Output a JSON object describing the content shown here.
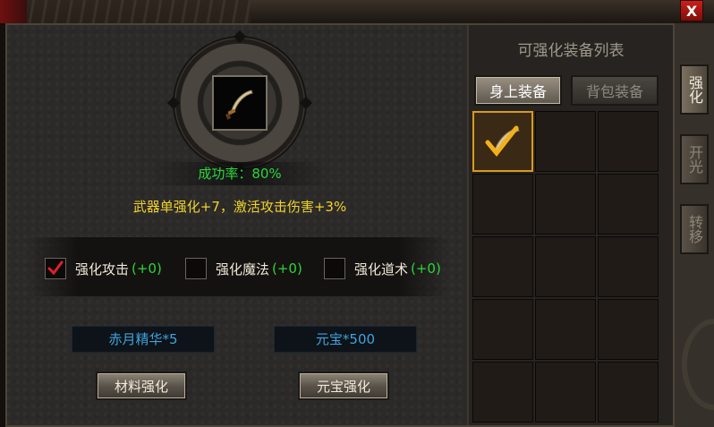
{
  "window": {
    "close_label": "X"
  },
  "enhance": {
    "success_rate": "成功率：80%",
    "description": "武器单强化+7，激活攻击伤害+3%",
    "options": [
      {
        "label": "强化攻击",
        "bonus": "(+0)",
        "checked": true
      },
      {
        "label": "强化魔法",
        "bonus": "(+0)",
        "checked": false
      },
      {
        "label": "强化道术",
        "bonus": "(+0)",
        "checked": false
      }
    ],
    "material_cost": "赤月精华*5",
    "gold_cost": "元宝*500",
    "material_button": "材料强化",
    "gold_button": "元宝强化"
  },
  "equipment_list": {
    "title": "可强化装备列表",
    "tab_equipped": "身上装备",
    "tab_bag": "背包装备"
  },
  "side_tabs": [
    "强化",
    "开光",
    "转移"
  ],
  "colors": {
    "success": "#2bd63a",
    "description": "#f1d22a",
    "cost": "#3fa3dd",
    "selected_border": "#d99a1c"
  },
  "icons": {
    "weapon": "curved-blade-icon",
    "check": "red-check-icon"
  }
}
